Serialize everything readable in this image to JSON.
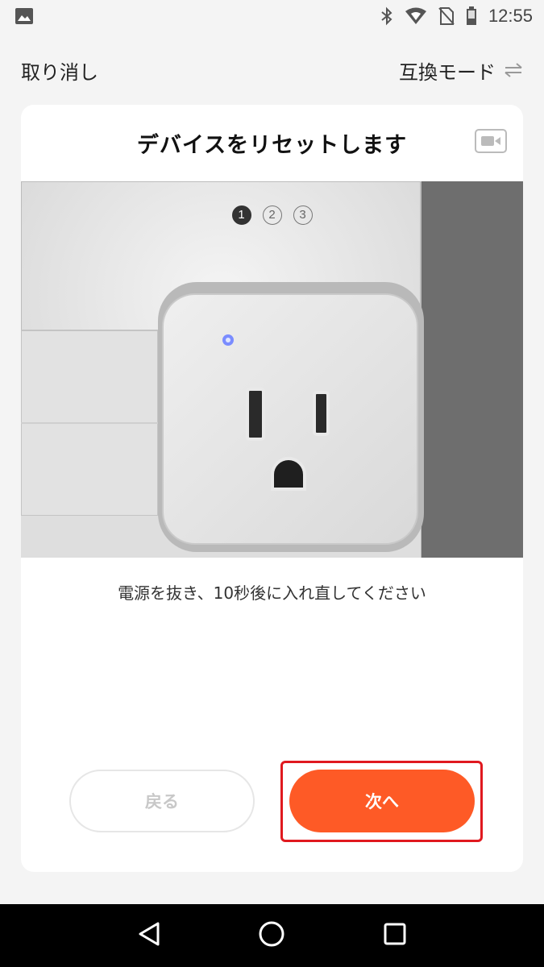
{
  "status_bar": {
    "time": "12:55",
    "icons": [
      "image-icon",
      "bluetooth-icon",
      "wifi-icon",
      "no-sim-icon",
      "battery-icon"
    ]
  },
  "nav": {
    "cancel_label": "取り消し",
    "compat_label": "互換モード",
    "compat_icon": "swap-icon"
  },
  "card": {
    "title": "デバイスをリセットします",
    "video_icon": "video-camera-icon",
    "steps": [
      "1",
      "2",
      "3"
    ],
    "active_step": 1,
    "illustration": "smart-plug-photo",
    "instruction": "電源を抜き、10秒後に入れ直してください",
    "back_label": "戻る",
    "next_label": "次へ"
  },
  "colors": {
    "accent": "#fe5a26",
    "highlight": "#e0191f",
    "background": "#f4f4f4"
  },
  "android_nav": {
    "icons": [
      "back-icon",
      "home-icon",
      "recents-icon"
    ]
  }
}
